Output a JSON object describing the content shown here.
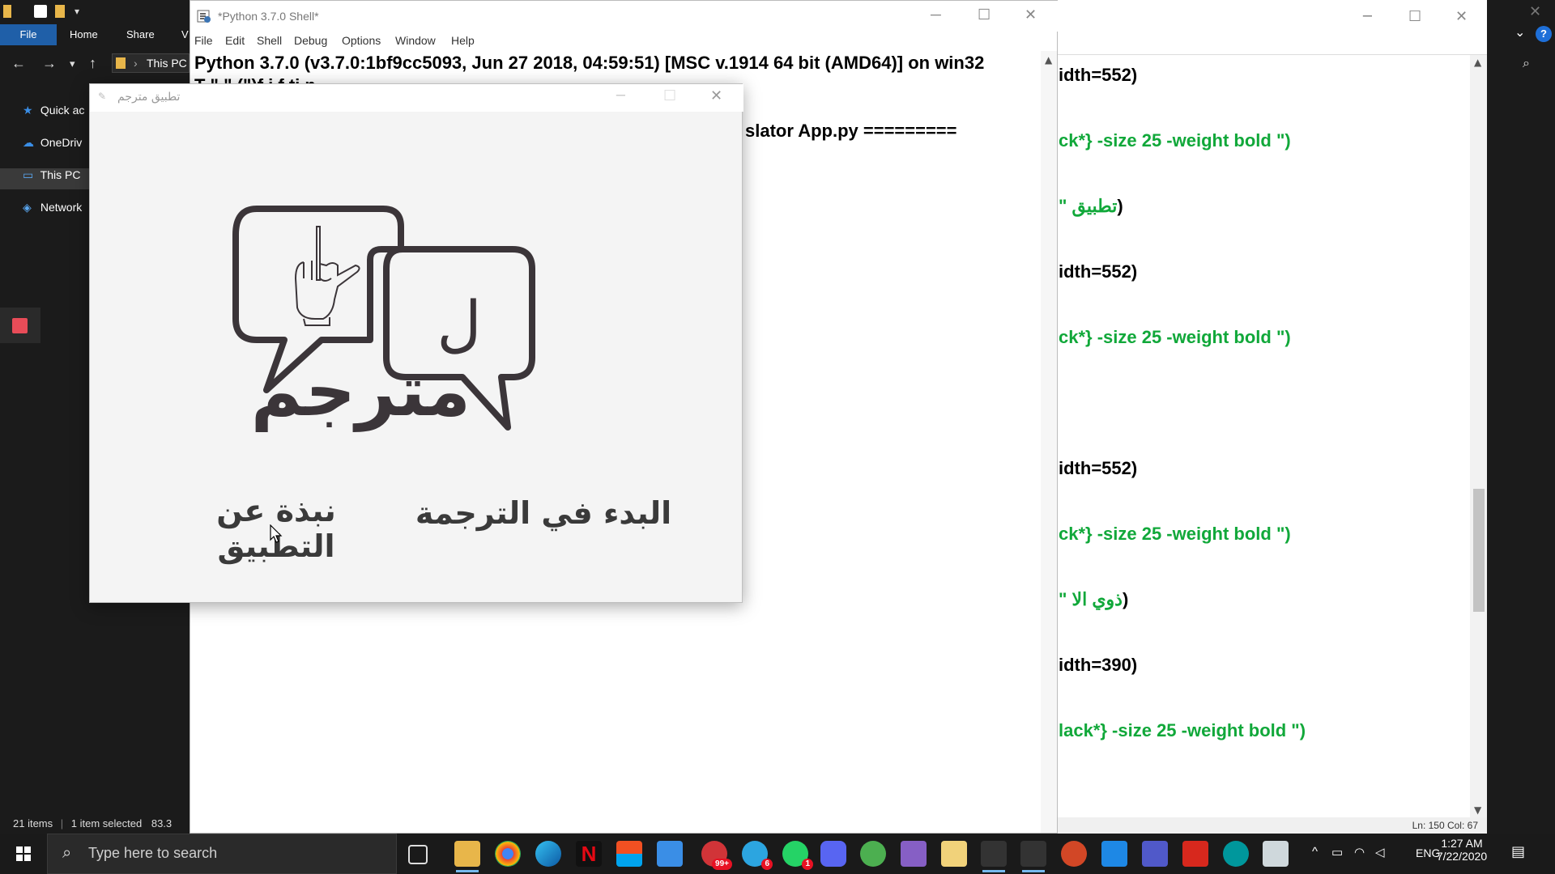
{
  "explorer": {
    "ribbon_tabs": [
      "File",
      "Home",
      "Share",
      "V"
    ],
    "address_crumb": "This PC",
    "nav_items": [
      "Quick ac",
      "OneDriv",
      "This PC",
      "Network"
    ],
    "status": {
      "items": "21 items",
      "selected": "1 item selected",
      "size": "83.3"
    }
  },
  "shell": {
    "title": "*Python 3.7.0 Shell*",
    "menu": [
      "File",
      "Edit",
      "Shell",
      "Debug",
      "Options",
      "Window",
      "Help"
    ],
    "lines": [
      "Python 3.7.0 (v3.7.0:1bf9cc5093, Jun 27 2018, 04:59:51) [MSC v.1914 64 bit (AMD64)] on win32",
      "T                                  \"                   \"                           (\")f                  i      f         ti    n.",
      "slator App.py ========="
    ]
  },
  "app": {
    "title": "تطبيق مترجم",
    "logo_letter": "ل",
    "logo_word": "مترجم",
    "start_button": "البدء في الترجمة",
    "about_button": "نبذة عن التطبيق",
    "colors": {
      "ink": "#3b3539",
      "background": "#f4f4f4"
    }
  },
  "editor": {
    "code_lines": [
      {
        "text": "idth=552)",
        "style": "black"
      },
      {
        "text": "ck*} -size 25 -weight bold \")",
        "style": "green",
        "tail": ")"
      },
      {
        "text": "تطبيق \"",
        "style": "green",
        "tail": ")"
      },
      {
        "text": "idth=552)",
        "style": "black"
      },
      {
        "text": "ck*} -size 25 -weight bold \")",
        "style": "green"
      },
      {
        "text": "",
        "style": "black"
      },
      {
        "text": "idth=552)",
        "style": "black"
      },
      {
        "text": "ck*} -size 25 -weight bold \")",
        "style": "green"
      },
      {
        "text": "ذوي الا \"",
        "style": "green",
        "tail": ")"
      },
      {
        "text": "idth=390)",
        "style": "black"
      },
      {
        "text": "lack*} -size 25 -weight bold \")",
        "style": "green"
      }
    ],
    "status": "Ln: 150   Col: 67",
    "colors": {
      "string": "#11a83a"
    }
  },
  "taskbar": {
    "search_placeholder": "Type here to search",
    "badges": {
      "mail": "99+",
      "app6": "6",
      "app1": "1"
    },
    "lang": "ENG",
    "time": "1:27 AM",
    "date": "7/22/2020"
  }
}
